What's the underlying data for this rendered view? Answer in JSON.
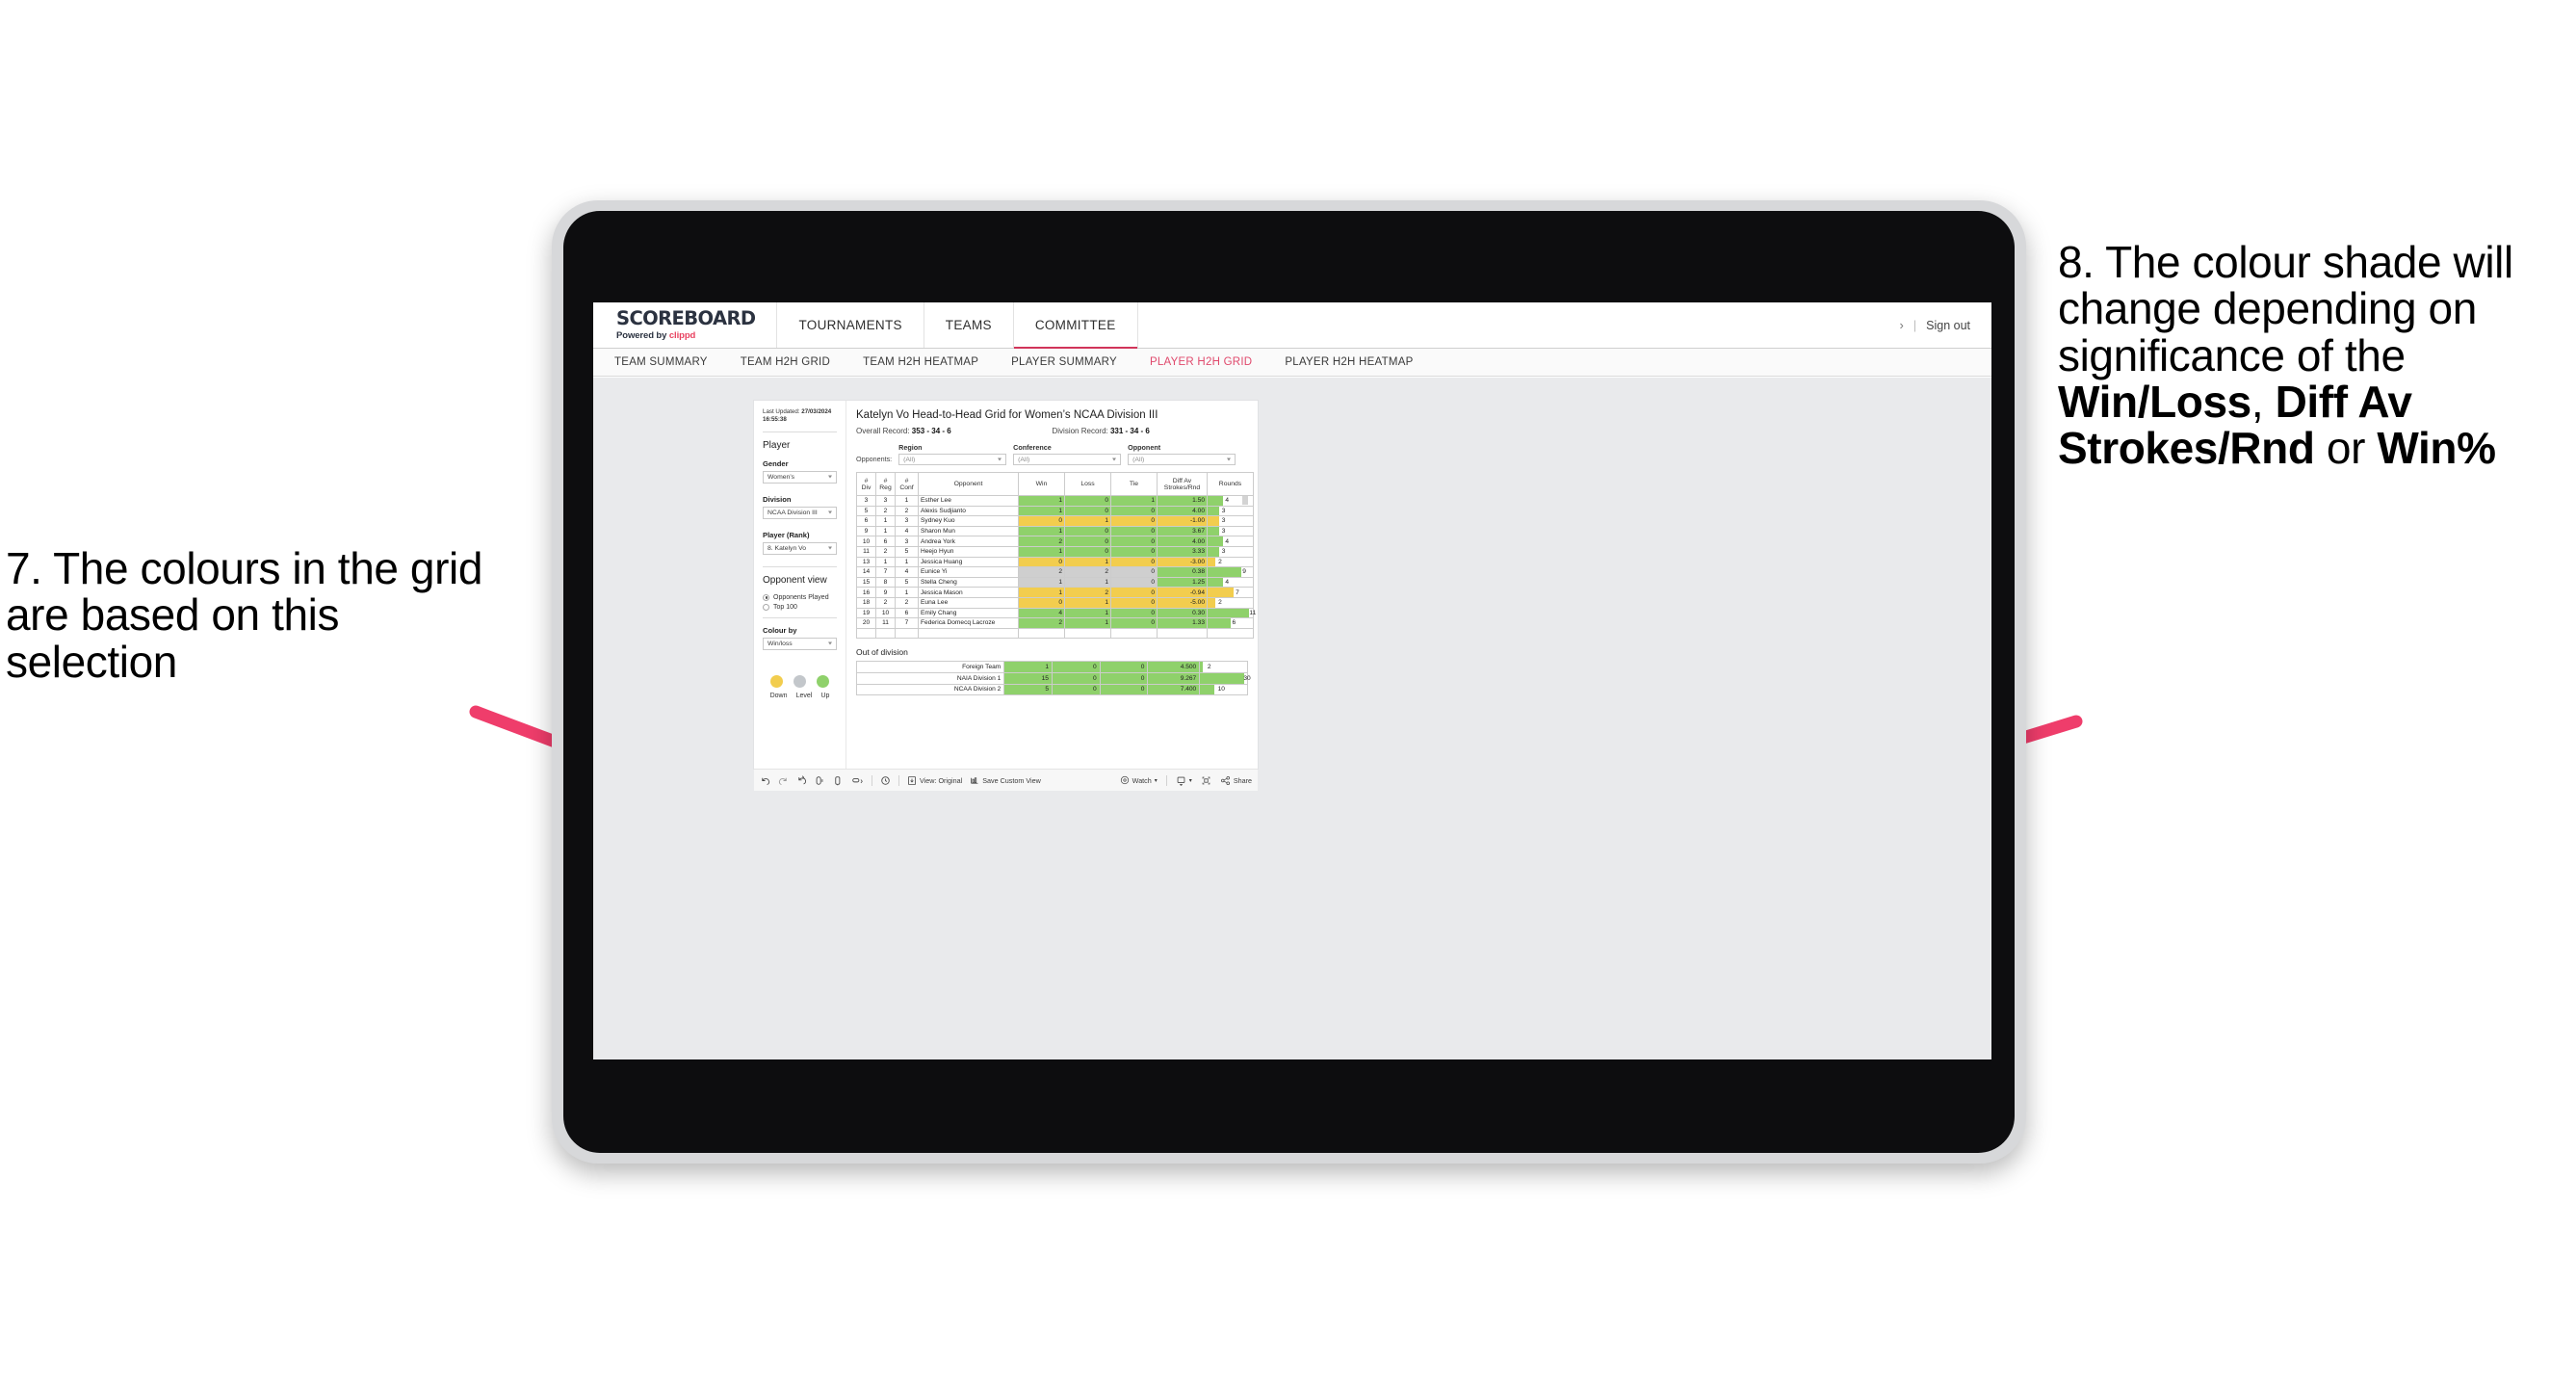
{
  "annotations": {
    "left": {
      "number": "7.",
      "text": "7. The colours in the grid are based on this selection"
    },
    "right": {
      "lead": "8. The colour shade will change depending on significance of the ",
      "b1": "Win/Loss",
      "sep1": ", ",
      "b2": "Diff Av Strokes/Rnd",
      "sep2": " or ",
      "b3": "Win%"
    },
    "arrow_color": "#ef3d6b"
  },
  "header": {
    "brand_title": "SCOREBOARD",
    "brand_sub_prefix": "Powered by ",
    "brand_sub_name": "clippd",
    "nav": [
      {
        "label": "TOURNAMENTS",
        "active": false
      },
      {
        "label": "TEAMS",
        "active": false
      },
      {
        "label": "COMMITTEE",
        "active": true
      }
    ],
    "chevron": "›",
    "divider": "|",
    "sign_out": "Sign out"
  },
  "subnav": [
    {
      "label": "TEAM SUMMARY",
      "active": false
    },
    {
      "label": "TEAM H2H GRID",
      "active": false
    },
    {
      "label": "TEAM H2H HEATMAP",
      "active": false
    },
    {
      "label": "PLAYER SUMMARY",
      "active": false
    },
    {
      "label": "PLAYER H2H GRID",
      "active": true
    },
    {
      "label": "PLAYER H2H HEATMAP",
      "active": false
    }
  ],
  "panel": {
    "last_updated_label": "Last Updated: ",
    "last_updated_value": "27/03/2024 16:55:38",
    "section_player": "Player",
    "gender_label": "Gender",
    "gender_value": "Women’s",
    "division_label": "Division",
    "division_value": "NCAA Division III",
    "player_label": "Player (Rank)",
    "player_value": "8. Katelyn Vo",
    "opponent_view_label": "Opponent view",
    "radios": [
      {
        "label": "Opponents Played",
        "checked": true
      },
      {
        "label": "Top 100",
        "checked": false
      }
    ],
    "colour_by_label": "Colour by",
    "colour_by_value": "Win/loss",
    "legend": [
      {
        "label": "Down",
        "color": "#f2cd4e"
      },
      {
        "label": "Level",
        "color": "#c3c7cb"
      },
      {
        "label": "Up",
        "color": "#8fd16b"
      }
    ]
  },
  "main": {
    "title": "Katelyn Vo Head-to-Head Grid for Women’s NCAA Division III",
    "overall_label": "Overall Record: ",
    "overall_value": "353 -  34 - 6",
    "division_label": "Division Record: ",
    "division_value": "331 -  34 - 6",
    "opponents_label": "Opponents:",
    "filters": [
      {
        "caption": "Region",
        "value": "(All)"
      },
      {
        "caption": "Conference",
        "value": "(All)"
      },
      {
        "caption": "Opponent",
        "value": "(All)"
      }
    ]
  },
  "chart_data": {
    "type": "table",
    "title": "Katelyn Vo Head-to-Head Grid for Women’s NCAA Division III",
    "columns": [
      "# Div",
      "# Reg",
      "# Conf",
      "Opponent",
      "Win",
      "Loss",
      "Tie",
      "Diff Av Strokes/Rnd",
      "Rounds"
    ],
    "column_lines": [
      [
        "#",
        "Div"
      ],
      [
        "#",
        "Reg"
      ],
      [
        "#",
        "Conf"
      ],
      [
        "Opponent"
      ],
      [
        "Win"
      ],
      [
        "Loss"
      ],
      [
        "Tie"
      ],
      [
        "Diff Av",
        "Strokes/Rnd"
      ],
      [
        "Rounds"
      ]
    ],
    "rounds_max": 12,
    "rows": [
      {
        "div": "3",
        "reg": "3",
        "conf": "1",
        "opponent": "Esther Lee",
        "win": "1",
        "loss": "0",
        "tie": "1",
        "diff": "1.50",
        "rounds": "4",
        "color": "green"
      },
      {
        "div": "5",
        "reg": "2",
        "conf": "2",
        "opponent": "Alexis Sudjianto",
        "win": "1",
        "loss": "0",
        "tie": "0",
        "diff": "4.00",
        "rounds": "3",
        "color": "green"
      },
      {
        "div": "6",
        "reg": "1",
        "conf": "3",
        "opponent": "Sydney Kuo",
        "win": "0",
        "loss": "1",
        "tie": "0",
        "diff": "-1.00",
        "rounds": "3",
        "color": "yellow"
      },
      {
        "div": "9",
        "reg": "1",
        "conf": "4",
        "opponent": "Sharon Mun",
        "win": "1",
        "loss": "0",
        "tie": "0",
        "diff": "3.67",
        "rounds": "3",
        "color": "green"
      },
      {
        "div": "10",
        "reg": "6",
        "conf": "3",
        "opponent": "Andrea York",
        "win": "2",
        "loss": "0",
        "tie": "0",
        "diff": "4.00",
        "rounds": "4",
        "color": "green"
      },
      {
        "div": "11",
        "reg": "2",
        "conf": "5",
        "opponent": "Heejo Hyun",
        "win": "1",
        "loss": "0",
        "tie": "0",
        "diff": "3.33",
        "rounds": "3",
        "color": "green"
      },
      {
        "div": "13",
        "reg": "1",
        "conf": "1",
        "opponent": "Jessica Huang",
        "win": "0",
        "loss": "1",
        "tie": "0",
        "diff": "-3.00",
        "rounds": "2",
        "color": "yellow"
      },
      {
        "div": "14",
        "reg": "7",
        "conf": "4",
        "opponent": "Eunice Yi",
        "win": "2",
        "loss": "2",
        "tie": "0",
        "diff": "0.38",
        "rounds": "9",
        "color": "grey",
        "diff_color": "green"
      },
      {
        "div": "15",
        "reg": "8",
        "conf": "5",
        "opponent": "Stella Cheng",
        "win": "1",
        "loss": "1",
        "tie": "0",
        "diff": "1.25",
        "rounds": "4",
        "color": "grey",
        "diff_color": "green"
      },
      {
        "div": "16",
        "reg": "9",
        "conf": "1",
        "opponent": "Jessica Mason",
        "win": "1",
        "loss": "2",
        "tie": "0",
        "diff": "-0.94",
        "rounds": "7",
        "color": "yellow"
      },
      {
        "div": "18",
        "reg": "2",
        "conf": "2",
        "opponent": "Euna Lee",
        "win": "0",
        "loss": "1",
        "tie": "0",
        "diff": "-5.00",
        "rounds": "2",
        "color": "yellow"
      },
      {
        "div": "19",
        "reg": "10",
        "conf": "6",
        "opponent": "Emily Chang",
        "win": "4",
        "loss": "1",
        "tie": "0",
        "diff": "0.30",
        "rounds": "11",
        "color": "green"
      },
      {
        "div": "20",
        "reg": "11",
        "conf": "7",
        "opponent": "Federica Domecq Lacroze",
        "win": "2",
        "loss": "1",
        "tie": "0",
        "diff": "1.33",
        "rounds": "6",
        "color": "green"
      }
    ],
    "out_of_division_title": "Out of division",
    "out_of_division": [
      {
        "name": "Foreign Team",
        "win": "1",
        "loss": "0",
        "tie": "0",
        "diff": "4.500",
        "rounds": "2",
        "color": "green"
      },
      {
        "name": "NAIA Division 1",
        "win": "15",
        "loss": "0",
        "tie": "0",
        "diff": "9.267",
        "rounds": "30",
        "color": "green"
      },
      {
        "name": "NCAA Division 2",
        "win": "5",
        "loss": "0",
        "tie": "0",
        "diff": "7.400",
        "rounds": "10",
        "color": "green"
      }
    ],
    "out_of_division_rounds_max": 32,
    "colors": {
      "green": "#8fd16b",
      "yellow": "#f2cd4e",
      "grey": "#cfcfcf"
    }
  },
  "toolbar": {
    "view_label": "View: Original",
    "save_label": "Save Custom View",
    "watch_label": "Watch",
    "share_label": "Share"
  }
}
